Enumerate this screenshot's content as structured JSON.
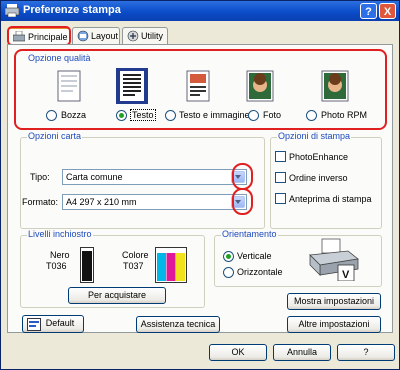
{
  "window": {
    "title": "Preferenze stampa"
  },
  "titlebar_buttons": {
    "help": "?",
    "close": "X"
  },
  "tabs": [
    {
      "label": "Principale",
      "icon": "printer-paper-icon",
      "selected": true
    },
    {
      "label": "Layout",
      "icon": "layout-icon",
      "selected": false
    },
    {
      "label": "Utility",
      "icon": "utility-icon",
      "selected": false
    }
  ],
  "quality": {
    "title": "Opzione qualità",
    "options": [
      {
        "label": "Bozza",
        "selected": false
      },
      {
        "label": "Testo",
        "selected": true
      },
      {
        "label": "Testo e immagine",
        "selected": false
      },
      {
        "label": "Foto",
        "selected": false
      },
      {
        "label": "Photo RPM",
        "selected": false
      }
    ]
  },
  "paper": {
    "title": "Opzioni carta",
    "type_label": "Tipo:",
    "type_value": "Carta comune",
    "format_label": "Formato:",
    "format_value": "A4 297 x 210 mm"
  },
  "print_options": {
    "title": "Opzioni di stampa",
    "items": [
      {
        "label": "PhotoEnhance",
        "checked": false
      },
      {
        "label": "Ordine inverso",
        "checked": false
      },
      {
        "label": "Anteprima di stampa",
        "checked": false
      }
    ]
  },
  "ink": {
    "title": "Livelli inchiostro",
    "black_label": "Nero",
    "black_code": "T036",
    "color_label": "Colore",
    "color_code": "T037",
    "buy_button": "Per acquistare"
  },
  "orientation": {
    "title": "Orientamento",
    "options": [
      {
        "label": "Verticale",
        "selected": true
      },
      {
        "label": "Orizzontale",
        "selected": false
      }
    ]
  },
  "buttons": {
    "default": "Default",
    "tech_support": "Assistenza tecnica",
    "show_settings": "Mostra impostazioni",
    "other_settings": "Altre impostazioni",
    "ok": "OK",
    "cancel": "Annulla",
    "help": "?"
  },
  "colors": {
    "highlight_red": "#e02020",
    "group_label_blue": "#1e4bbd",
    "title_blue": "#0b4cc9"
  }
}
